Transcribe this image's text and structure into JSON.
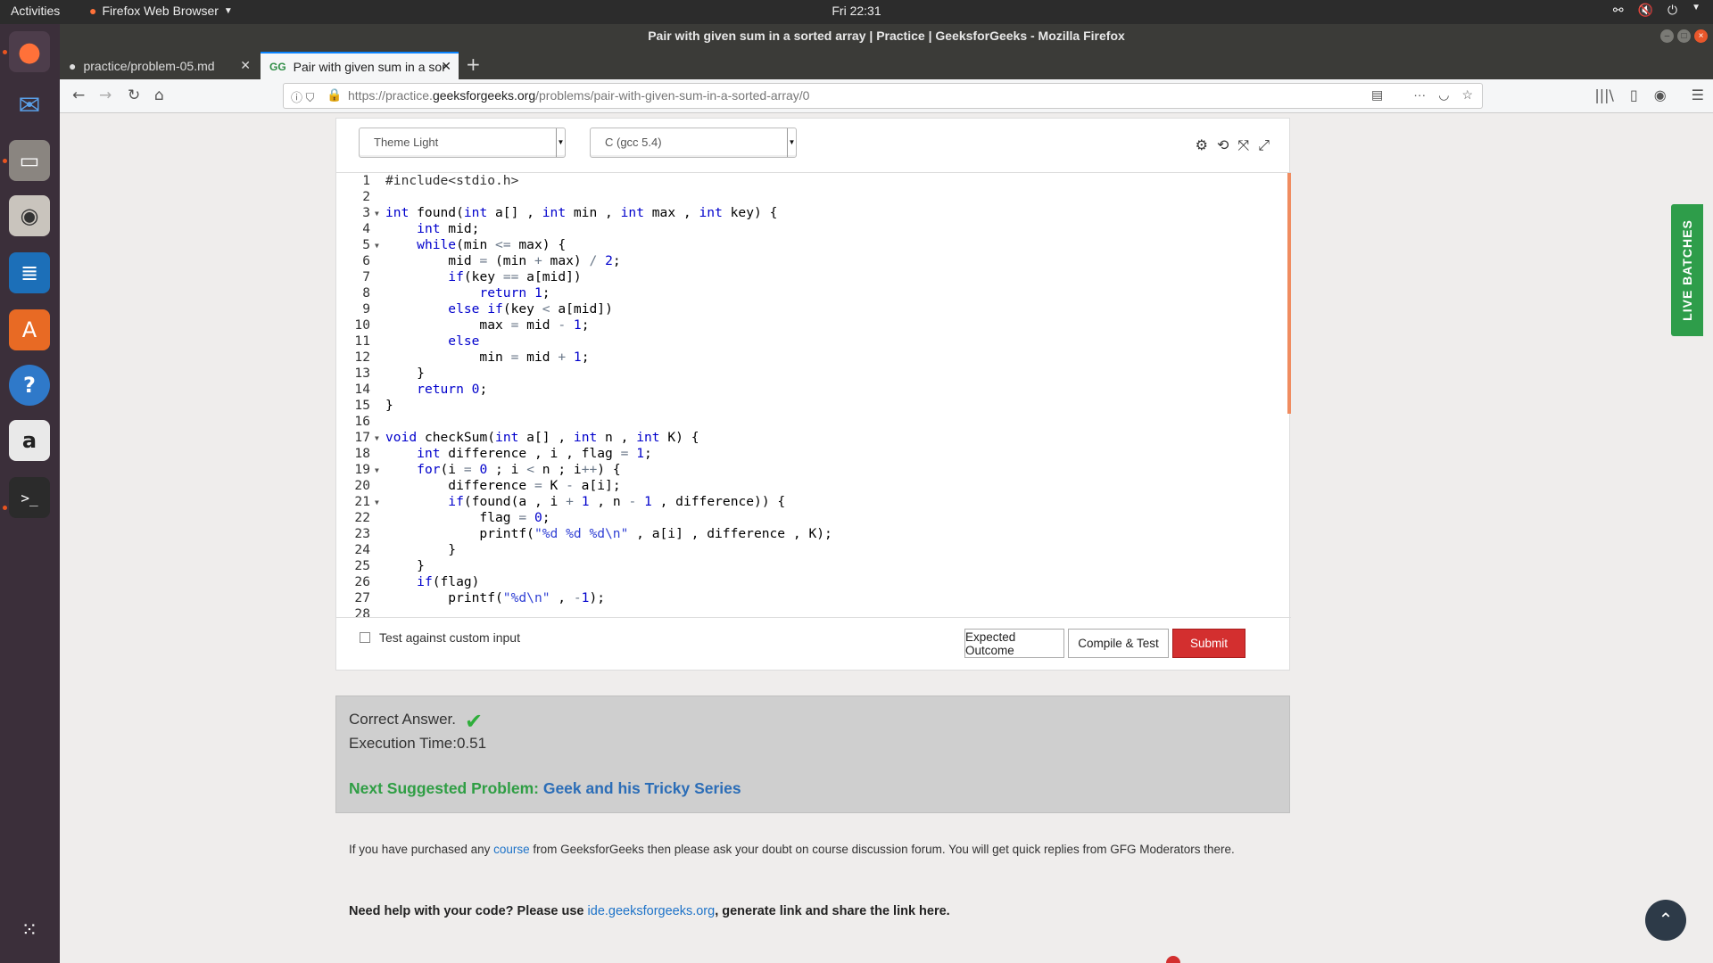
{
  "system": {
    "activities": "Activities",
    "app_name": "Firefox Web Browser",
    "clock": "Fri 22:31"
  },
  "window": {
    "title": "Pair with given sum in a sorted array | Practice | GeeksforGeeks - Mozilla Firefox"
  },
  "tabs": [
    {
      "label": "practice/problem-05.md"
    },
    {
      "label": "Pair with given sum in a sorted array"
    }
  ],
  "url": {
    "prefix": "https://practice.",
    "domain": "geeksforgeeks.org",
    "path": "/problems/pair-with-given-sum-in-a-sorted-array/0"
  },
  "editor": {
    "theme": "Theme Light",
    "language": "C (gcc 5.4)",
    "line_numbers": [
      "1",
      "2",
      "3",
      "4",
      "5",
      "6",
      "7",
      "8",
      "9",
      "10",
      "11",
      "12",
      "13",
      "14",
      "15",
      "16",
      "17",
      "18",
      "19",
      "20",
      "21",
      "22",
      "23",
      "24",
      "25",
      "26",
      "27",
      "28"
    ],
    "lines": [
      "#include<stdio.h>",
      "",
      "int found(int a[] , int min , int max , int key) {",
      "    int mid;",
      "    while(min <= max) {",
      "        mid = (min + max) / 2;",
      "        if(key == a[mid])",
      "            return 1;",
      "        else if(key < a[mid])",
      "            max = mid - 1;",
      "        else",
      "            min = mid + 1;",
      "    }",
      "    return 0;",
      "}",
      "",
      "void checkSum(int a[] , int n , int K) {",
      "    int difference , i , flag = 1;",
      "    for(i = 0 ; i < n ; i++) {",
      "        difference = K - a[i];",
      "        if(found(a , i + 1 , n - 1 , difference)) {",
      "            flag = 0;",
      "            printf(\"%d %d %d\\n\" , a[i] , difference , K);",
      "        }",
      "    }",
      "    if(flag)",
      "        printf(\"%d\\n\" , -1);",
      ""
    ]
  },
  "custom_input_label": "Test against custom input",
  "buttons": {
    "expected": "Expected Outcome",
    "compile": "Compile & Test",
    "submit": "Submit"
  },
  "result": {
    "status": "Correct Answer.",
    "exec_time": "Execution Time:0.51",
    "next_label": "Next Suggested Problem: ",
    "next_problem": "Geek and his Tricky Series"
  },
  "note": {
    "pre": "If you have purchased any ",
    "link": "course",
    "post": " from GeeksforGeeks then please ask your doubt on course discussion forum. You will get quick replies from GFG Moderators there."
  },
  "help": {
    "pre": "Need help with your code? Please use ",
    "link": "ide.geeksforgeeks.org",
    "post": ", generate link and share the link here."
  },
  "live_batches": "LIVE BATCHES"
}
